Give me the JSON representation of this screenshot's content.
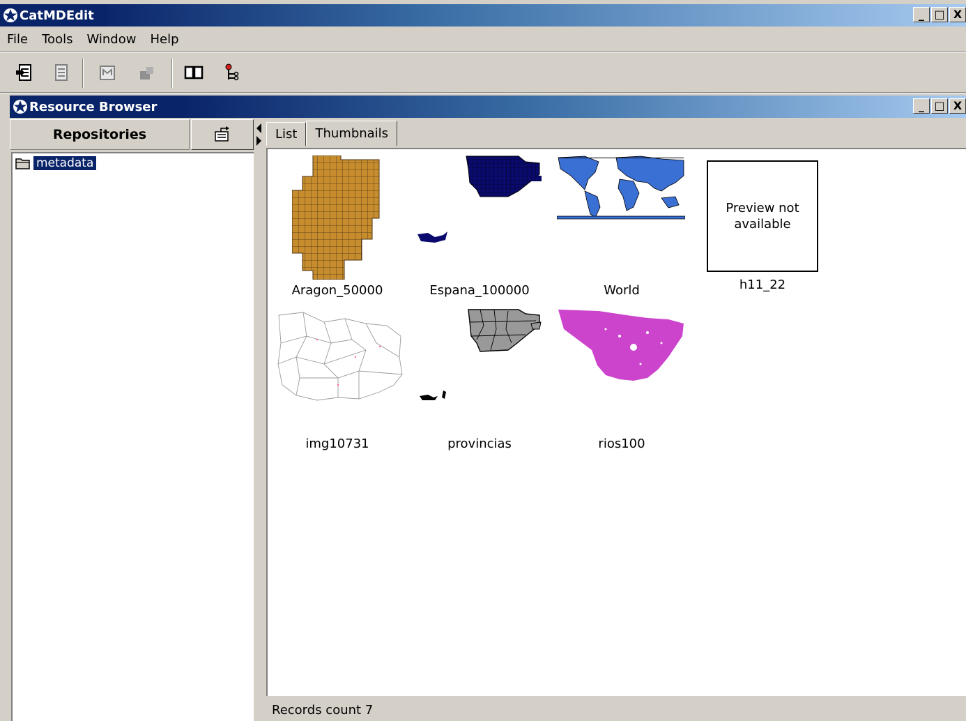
{
  "app": {
    "title": "CatMDEdit"
  },
  "menu": {
    "file": "File",
    "tools": "Tools",
    "window": "Window",
    "help": "Help"
  },
  "window_buttons": {
    "minimize": "_",
    "maximize": "□",
    "close": "X"
  },
  "toolbar": {
    "icons": [
      "import-icon",
      "export-icon",
      "metadata-icon",
      "edit-icon",
      "book-icon",
      "tree-icon"
    ]
  },
  "browser": {
    "title": "Resource Browser",
    "repositories_header": "Repositories",
    "tree_items": [
      {
        "label": "metadata"
      }
    ],
    "tabs": [
      {
        "label": "List"
      },
      {
        "label": "Thumbnails"
      }
    ],
    "active_tab": "Thumbnails",
    "thumbnails": [
      {
        "label": "Aragon_50000",
        "color": "#c68c2e"
      },
      {
        "label": "Espana_100000",
        "color": "#0a0a6e"
      },
      {
        "label": "World",
        "color": "#3a6fd4"
      },
      {
        "label": "h11_22",
        "preview_text": "Preview not available"
      },
      {
        "label": "img10731",
        "color": "#9a9a9a"
      },
      {
        "label": "provincias",
        "color": "#999999"
      },
      {
        "label": "rios100",
        "color": "#cc44cc"
      }
    ],
    "status": "Records count 7"
  }
}
